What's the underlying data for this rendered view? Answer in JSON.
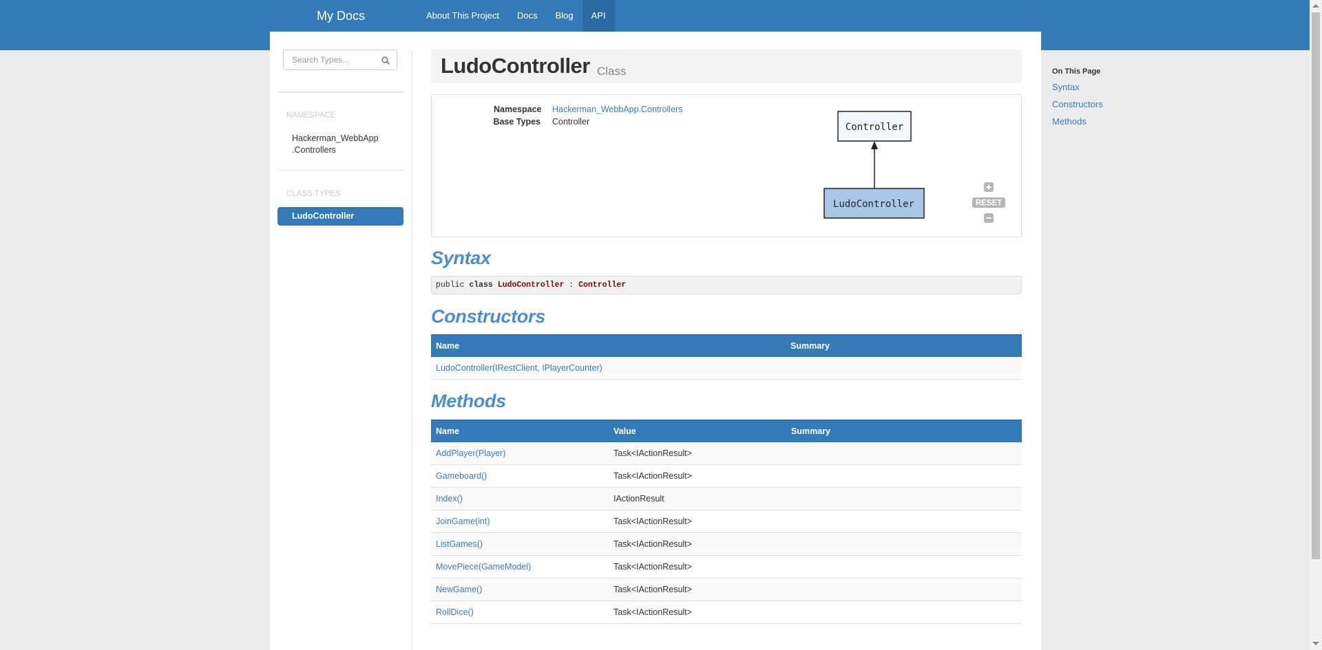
{
  "navbar": {
    "brand": "My Docs",
    "links": [
      {
        "label": "About This Project"
      },
      {
        "label": "Docs"
      },
      {
        "label": "Blog"
      },
      {
        "label": "API",
        "active": true
      }
    ]
  },
  "sidebar": {
    "search_placeholder": "Search Types...",
    "namespace_label": "NAMESPACE",
    "namespace_value_line1": "Hackerman_WebbApp",
    "namespace_value_line2": ".Controllers",
    "class_types_label": "CLASS TYPES",
    "class_items": [
      "LudoController"
    ]
  },
  "header": {
    "title": "LudoController",
    "kind": "Class"
  },
  "info": {
    "namespace_key": "Namespace",
    "namespace_value": "Hackerman_WebbApp.Controllers",
    "base_types_key": "Base Types",
    "base_types_value": "Controller",
    "diagram_parent": "Controller",
    "diagram_child": "LudoController",
    "zoom_reset": "RESET"
  },
  "syntax": {
    "heading": "Syntax",
    "code": {
      "kw1": "public",
      "kw2": "class",
      "type_name": "LudoController",
      "sep": ":",
      "base": "Controller"
    }
  },
  "constructors": {
    "heading": "Constructors",
    "columns": [
      "Name",
      "Summary"
    ],
    "rows": [
      {
        "name": "LudoController(IRestClient, IPlayerCounter)",
        "summary": ""
      }
    ]
  },
  "methods": {
    "heading": "Methods",
    "columns": [
      "Name",
      "Value",
      "Summary"
    ],
    "rows": [
      {
        "name": "AddPlayer(Player)",
        "value": "Task<IActionResult>",
        "summary": ""
      },
      {
        "name": "Gameboard()",
        "value": "Task<IActionResult>",
        "summary": ""
      },
      {
        "name": "Index()",
        "value": "IActionResult",
        "summary": ""
      },
      {
        "name": "JoinGame(int)",
        "value": "Task<IActionResult>",
        "summary": ""
      },
      {
        "name": "ListGames()",
        "value": "Task<IActionResult>",
        "summary": ""
      },
      {
        "name": "MovePiece(GameModel)",
        "value": "Task<IActionResult>",
        "summary": ""
      },
      {
        "name": "NewGame()",
        "value": "Task<IActionResult>",
        "summary": ""
      },
      {
        "name": "RollDice()",
        "value": "Task<IActionResult>",
        "summary": ""
      }
    ]
  },
  "on_this_page": {
    "title": "On This Page",
    "links": [
      "Syntax",
      "Constructors",
      "Methods"
    ]
  },
  "colors": {
    "primary": "#337ab7",
    "link": "#3b7bbf",
    "heading": "#4a8ed0",
    "diagram_child_fill": "#a9c8e8"
  }
}
